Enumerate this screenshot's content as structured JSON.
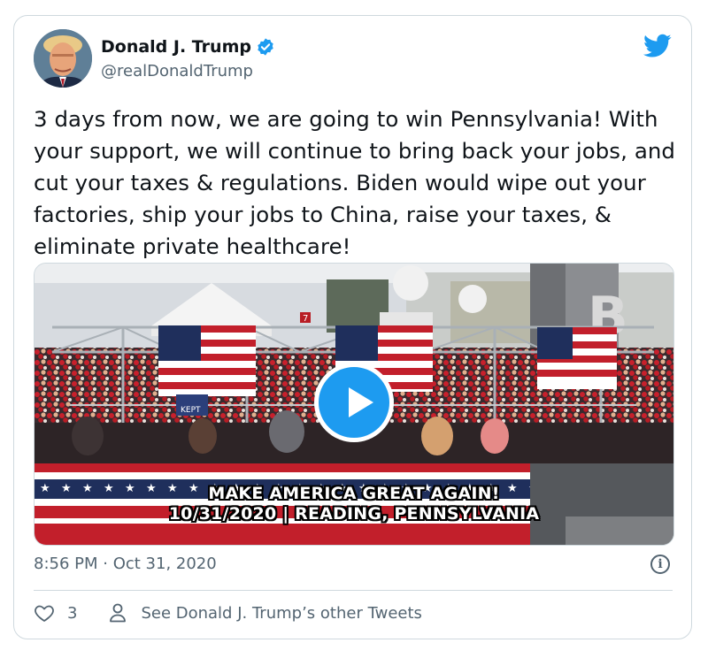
{
  "tweet": {
    "author_name": "Donald J. Trump",
    "author_handle": "@realDonaldTrump",
    "text": "3 days from now, we are going to win Pennsylvania! With your support, we will continue to bring back your jobs, and cut your taxes & regulations. Biden would wipe out your factories, ship your jobs to China, raise your taxes, & eliminate private healthcare!",
    "timestamp": "8:56 PM · Oct 31, 2020",
    "like_count": "3",
    "other_tweets_label": "See Donald J. Trump’s other Tweets"
  },
  "video": {
    "caption_line1": "MAKE AMERICA GREAT AGAIN!",
    "caption_line2": "10/31/2020 | READING, PENNSYLVANIA",
    "platform_number": "7",
    "sign_text": "KEPT"
  },
  "icons": {
    "verified": "verified-badge-icon",
    "brand": "twitter-bird-icon",
    "play": "play-icon",
    "info": "info-icon",
    "like": "heart-icon",
    "profile": "person-icon"
  },
  "colors": {
    "accent": "#1d9bf0",
    "text_primary": "#0f1419",
    "text_secondary": "#536471",
    "border": "#cfd9de"
  }
}
